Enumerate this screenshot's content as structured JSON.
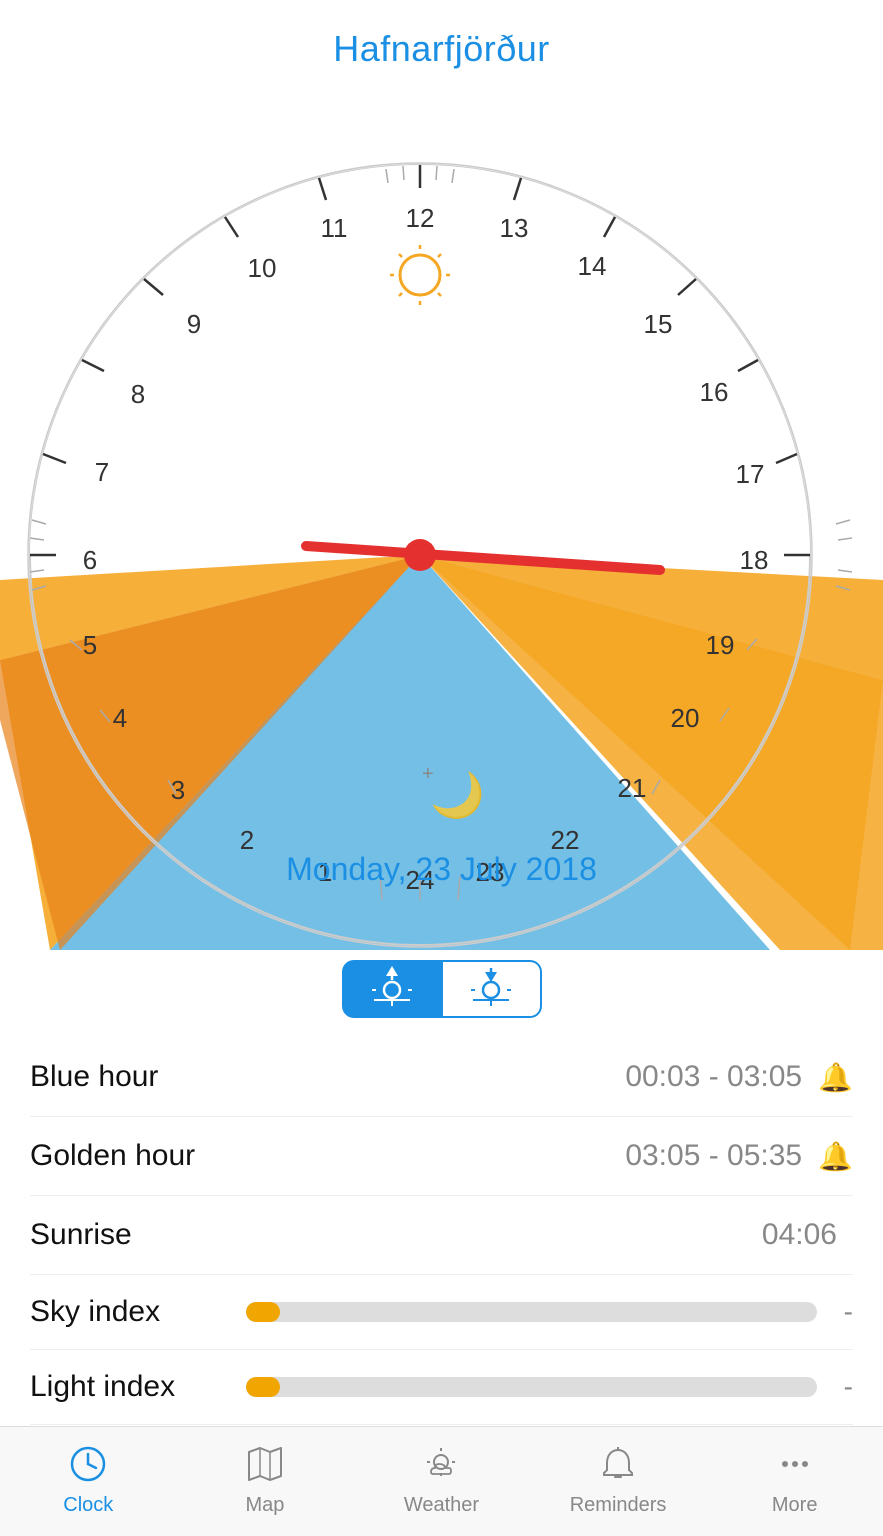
{
  "header": {
    "title": "Hafnarfjörður"
  },
  "clock": {
    "date": "Monday, 23 July 2018",
    "current_hour": 18,
    "hour_numbers": [
      6,
      7,
      8,
      9,
      10,
      11,
      12,
      13,
      14,
      15,
      16,
      17,
      18,
      19,
      20,
      21,
      22,
      23,
      24,
      1,
      2,
      3,
      4,
      5
    ],
    "sunrise_angle_deg": -150,
    "sunset_angle_deg": 30
  },
  "toggle": {
    "sunrise_label": "☀",
    "sunset_label": "☀"
  },
  "info_rows": [
    {
      "label": "Blue hour",
      "value": "00:03 - 03:05",
      "has_bell": true
    },
    {
      "label": "Golden hour",
      "value": "03:05 - 05:35",
      "has_bell": true
    },
    {
      "label": "Sunrise",
      "value": "04:06",
      "has_bell": false
    }
  ],
  "progress_rows": [
    {
      "label": "Sky index",
      "fill_pct": 5,
      "value": "-"
    },
    {
      "label": "Light index",
      "fill_pct": 5,
      "value": "-"
    }
  ],
  "nav": {
    "items": [
      {
        "id": "clock",
        "label": "Clock",
        "active": true
      },
      {
        "id": "map",
        "label": "Map",
        "active": false
      },
      {
        "id": "weather",
        "label": "Weather",
        "active": false
      },
      {
        "id": "reminders",
        "label": "Reminders",
        "active": false
      },
      {
        "id": "more",
        "label": "More",
        "active": false
      }
    ]
  },
  "colors": {
    "blue": "#1a8fe3",
    "orange": "#f0a500",
    "golden": "#f5a623",
    "red": "#e53030",
    "sky_blue": "#5ab4e0",
    "sun_color": "#f5a623"
  }
}
